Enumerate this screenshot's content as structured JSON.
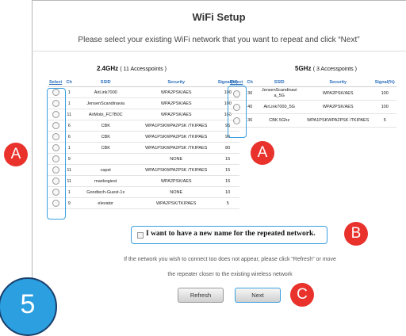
{
  "title": "WiFi Setup",
  "subtitle": "Please select your existing WiFi network that you want to repeat and click “Next”",
  "band24": {
    "name": "2.4GHz",
    "count": "( 11 Accesspoints )",
    "headers": [
      "Select",
      "Ch",
      "SSID",
      "Security",
      "Signal(%)"
    ],
    "rows": [
      [
        "1",
        "AirLink7000",
        "WPA2PSK/AES",
        "100"
      ],
      [
        "1",
        "JensenScandinavia",
        "WPA2PSK/AES",
        "100"
      ],
      [
        "11",
        "AirMobi_FC7B0C",
        "WPA2PSK/AES",
        "100"
      ],
      [
        "6",
        "CBK",
        "WPA1PSKWPA2PSK /TKIPAES",
        "96"
      ],
      [
        "6",
        "CBK",
        "WPA1PSKWPA2PSK /TKIPAES",
        "96"
      ],
      [
        "1",
        "CBK",
        "WPA1PSKWPA2PSK /TKIPAES",
        "80"
      ],
      [
        "9",
        "",
        "NONE",
        "15"
      ],
      [
        "11",
        "capst",
        "WPA1PSKWPA2PSK /TKIPAES",
        "15"
      ],
      [
        "11",
        "maxbogiest",
        "WPA2PSK/AES",
        "15"
      ],
      [
        "1",
        "Goodtech-Guest-1x",
        "NONE",
        "10"
      ],
      [
        "9",
        "elevator",
        "WPA2PSK/TKIPAES",
        "5"
      ]
    ]
  },
  "band5": {
    "name": "5GHz",
    "count": "( 3 Accesspoints )",
    "headers": [
      "Select",
      "Ch",
      "SSID",
      "Security",
      "Signal(%)"
    ],
    "rows": [
      [
        "36",
        "JensenScandinavi a_5G",
        "WPA2PSK/AES",
        "100"
      ],
      [
        "40",
        "AirLink7000_5G",
        "WPA2PSK/AES",
        "100"
      ],
      [
        "36",
        "CBK 5Ghz",
        "WPA1PSKWPA2PSK /TKIPAES",
        "5"
      ]
    ]
  },
  "new_name_label": "I want to have a new name for the repeated network.",
  "note_line1": "If the network you wish to connect too does not appear, please click “Refresh” or move",
  "note_line2": "the repeater closer to the existing wireless network",
  "buttons": {
    "refresh": "Refresh",
    "next": "Next"
  },
  "callouts": {
    "a": "A",
    "b": "B",
    "c": "C",
    "step": "5"
  },
  "colors": {
    "header_blue": "#2a6ebb",
    "highlight": "#3aa0e0",
    "callout_red": "#e8322b",
    "step_blue": "#2b9fe0"
  }
}
